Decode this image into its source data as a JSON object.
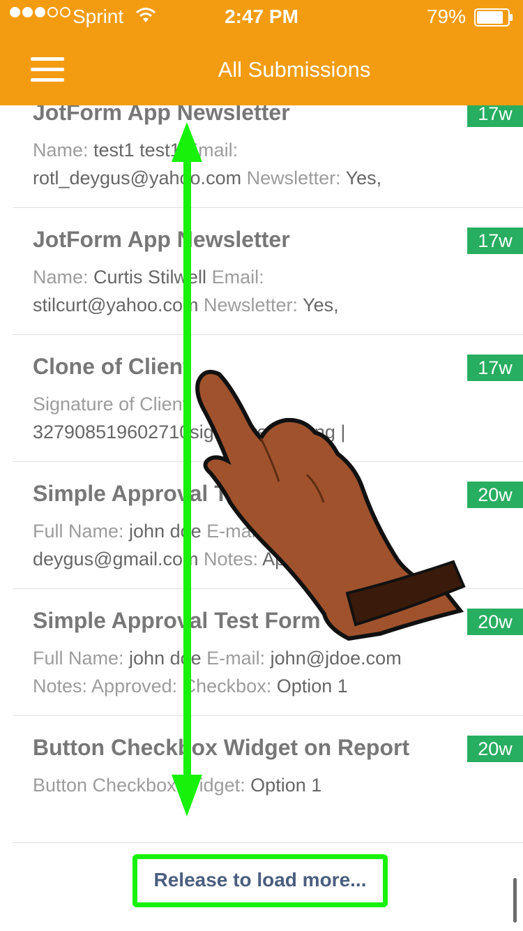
{
  "status_bar": {
    "carrier": "Sprint",
    "time": "2:47 PM",
    "battery_percent": "79%",
    "signal_strength": 3,
    "signal_total": 5
  },
  "nav": {
    "title": "All Submissions",
    "menu_icon": "hamburger-menu-icon"
  },
  "submissions": [
    {
      "title": "JotForm App Newsletter",
      "age": "17w",
      "desc_parts": [
        {
          "t": "Name: ",
          "k": true
        },
        {
          "t": "test1 test1 "
        },
        {
          "t": "Email:",
          "k": true
        },
        {
          "t": " rotl_deygus@yahoo.com "
        },
        {
          "t": "Newsletter:",
          "k": true
        },
        {
          "t": " Yes,"
        }
      ]
    },
    {
      "title": "JotForm App Newsletter",
      "age": "17w",
      "desc_parts": [
        {
          "t": "Name: ",
          "k": true
        },
        {
          "t": "Curtis Stilwell "
        },
        {
          "t": "Email:",
          "k": true
        },
        {
          "t": " stilcurt@yahoo.com "
        },
        {
          "t": "Newsletter:",
          "k": true
        },
        {
          "t": " Yes,"
        }
      ]
    },
    {
      "title": "Clone of Client",
      "age": "17w",
      "desc_parts": [
        {
          "t": "Signature of Client",
          "k": true
        },
        {
          "t": " 327908519602710"
        },
        {
          "t": "signature_27.png |"
        }
      ]
    },
    {
      "title": "Simple Approval Test Form",
      "age": "20w",
      "desc_parts": [
        {
          "t": "Full Name: ",
          "k": true
        },
        {
          "t": "john doe "
        },
        {
          "t": "E-mail: ",
          "k": true
        },
        {
          "t": "deygus@gmail.com "
        },
        {
          "t": "Notes: ",
          "k": true
        },
        {
          "t": "Approve"
        }
      ]
    },
    {
      "title": "Simple Approval Test Form",
      "age": "20w",
      "desc_parts": [
        {
          "t": "Full Name: ",
          "k": true
        },
        {
          "t": "john doe "
        },
        {
          "t": "E-mail: ",
          "k": true
        },
        {
          "t": "john@jdoe.com"
        },
        {
          "t": " Notes:  Approved: Checkbox: ",
          "k": true
        },
        {
          "t": "Option 1"
        }
      ]
    },
    {
      "title": "Button Checkbox Widget on Report",
      "age": "20w",
      "desc_parts": [
        {
          "t": "Button Checkbox Widget: ",
          "k": true
        },
        {
          "t": "Option 1"
        }
      ]
    }
  ],
  "load_more": {
    "label": "Release to load more..."
  },
  "colors": {
    "header_bg": "#F39C12",
    "badge_bg": "#27AE60",
    "highlight": "#18F20A",
    "load_more_text": "#4A5E7F"
  },
  "overlay": {
    "gesture": "swipe-up-down-arrow",
    "hand_icon": "pointing-hand-icon"
  }
}
